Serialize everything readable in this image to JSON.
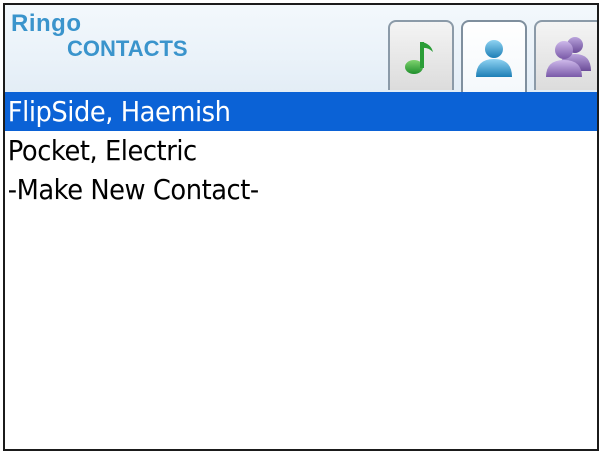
{
  "app": {
    "brand_top": "Ringo",
    "brand_bottom": "CONTACTS"
  },
  "tabs": [
    {
      "name": "music",
      "icon": "music-note-icon",
      "active": false
    },
    {
      "name": "contact",
      "icon": "person-icon",
      "active": true
    },
    {
      "name": "group",
      "icon": "people-group-icon",
      "active": false
    }
  ],
  "contacts": [
    {
      "label": "FlipSide, Haemish",
      "selected": true
    },
    {
      "label": "Pocket, Electric",
      "selected": false
    },
    {
      "label": "-Make New Contact-",
      "selected": false
    }
  ],
  "colors": {
    "brand": "#3a94cc",
    "selection": "#0b62d6",
    "music_icon": "#2ea83a",
    "contact_icon": "#3b9fd0",
    "group_icon": "#9b7fc0"
  }
}
